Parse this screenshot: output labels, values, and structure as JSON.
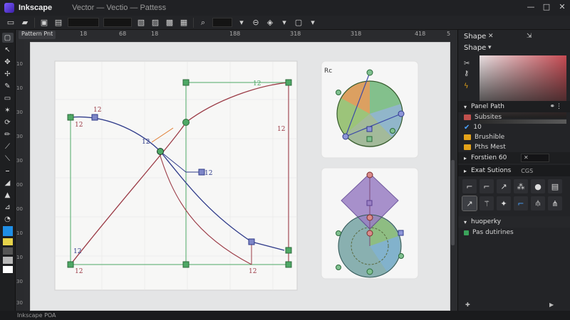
{
  "window": {
    "app_name": "Inkscape",
    "doc_title": "Vector — Vectio — Pattess",
    "controls": {
      "minimize": "—",
      "maximize": "□",
      "close": "✕"
    }
  },
  "canvas": {
    "doc_tab": "Pattern Pnt",
    "ruler_top": [
      "18",
      "68",
      "18",
      "188",
      "318",
      "318",
      "418",
      "5"
    ],
    "ruler_left": [
      "10",
      "10",
      "30",
      "30",
      "30",
      "00",
      "00",
      "10",
      "10",
      "30",
      "30"
    ],
    "labels": {
      "node_label_1": "12",
      "node_label_2": "12",
      "node_label_3": "12",
      "node_label_4": "12",
      "node_label_5": "12",
      "node_label_6": "12",
      "node_label_7": "12",
      "node_label_8": "12",
      "node_label_9": "12",
      "tool_tip": "Rc"
    }
  },
  "dock": {
    "tab_1": "Shape",
    "tab_2": "Shape",
    "panel_1": {
      "title": "Panel Path",
      "rows": [
        {
          "label": "Subsites",
          "swatch": "#c0504d"
        },
        {
          "label": "10",
          "swatch": "#4aa3ff"
        },
        {
          "label": "Brushible",
          "swatch": "#e3a21a"
        },
        {
          "label": "Pths Mest",
          "swatch": "#e3a21a"
        }
      ]
    },
    "panel_2": {
      "title": "Forstien 60"
    },
    "panel_3": {
      "title": "Exat Sutions",
      "badge": "CGS"
    },
    "panel_4": {
      "title": "huoperky",
      "row": "Pas dutirines"
    }
  },
  "status": {
    "text": "Inkscape POA"
  },
  "colors": {
    "accent": "#1f8fe6",
    "path_red": "#9b3b46",
    "path_blue": "#2f3b8a",
    "node_green": "#3aa35a"
  }
}
